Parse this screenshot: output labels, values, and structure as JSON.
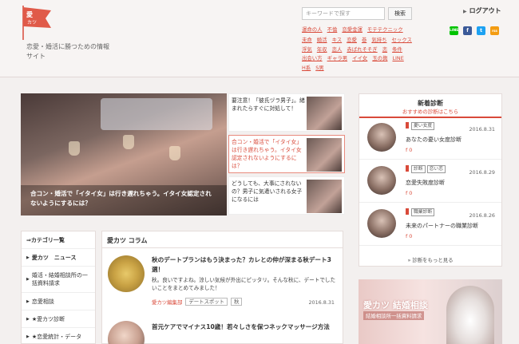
{
  "header": {
    "logo_text": "愛カツ",
    "tagline": "恋愛・婚活に勝つための情報サイト",
    "search_placeholder": "キーワードで探す",
    "search_button": "検索",
    "login": "ログアウト",
    "tag_rows": [
      [
        "運命の人",
        "不倫",
        "恋愛金運",
        "モテテクニック"
      ],
      [
        "未命",
        "婚活",
        "キス",
        "恋愛",
        "巻",
        "気持ち",
        "セックス"
      ],
      [
        "浮気",
        "年収",
        "恋人",
        "赤ばれそそぎ",
        "恋",
        "条件"
      ],
      [
        "出会い方",
        "ギャラ男",
        "イイ女",
        "玉の輿",
        "LINE"
      ],
      [
        "H系",
        "S男"
      ]
    ],
    "social": [
      "LINE",
      "f",
      "t",
      "rss"
    ]
  },
  "hero": {
    "caption": "合コン・婚活で「イタイ女」は行き遅れちゃう。イタイ女認定されないようにするには？"
  },
  "side_articles": [
    "要注意！「彼氏ヅラ男子」。緒まれたらすぐに対処して！",
    "合コン・婚活で「イタイ女」は行き遅れちゃう。イタイ女認定されないようにするには？",
    "どうしても、大事にされないの？男子に気遣いされる女子になるには"
  ],
  "diagnostics": {
    "title": "新着診断",
    "subtitle": "おすすめの診断はこちら",
    "items": [
      {
        "tags": [
          "憂い女度"
        ],
        "name": "あなたの憂い女度診断",
        "date": "2016.8.31",
        "count": "0"
      },
      {
        "tags": [
          "診断",
          "恋い恋"
        ],
        "name": "恋愛失敗度診断",
        "date": "2016.8.29",
        "count": "0"
      },
      {
        "tags": [
          "職業診断"
        ],
        "name": "未来のパートナーの職業診断",
        "date": "2016.8.26",
        "count": "0"
      }
    ],
    "more": "診断をもっと見る"
  },
  "banner": {
    "title": "愛カツ 結婚相談",
    "subtitle": "結婚相談所一括資料請求"
  },
  "category_nav": [
    "⇒カテゴリ一覧",
    "愛カツ　ニュース",
    "婚活・結婚相談所の一括資料請求",
    "恋愛相談",
    "★愛カツ診断",
    "★恋愛統計・データ"
  ],
  "column": {
    "title": "愛カツ コラム",
    "articles": [
      {
        "title": "秋のデートプランはもう決まった？カレとの仲が深まる秋デート3選！",
        "desc": "秋。良いですよね。涼しい気候が外出にピッタリ。そんな秋に、デートでしたいことをまとめてみました！",
        "author": "愛カツ編集部",
        "tags": [
          "デートスポット",
          "秋"
        ],
        "date": "2016.8.31"
      },
      {
        "title": "首元ケアでマイナス10歳！若々しさを保つネックマッサージ方法",
        "desc": "",
        "author": "",
        "tags": [],
        "date": ""
      }
    ]
  },
  "colors": {
    "accent": "#d94a3a",
    "line": "#00c300",
    "facebook": "#3b5998",
    "twitter": "#1da1f2",
    "rss": "#f39c12"
  }
}
